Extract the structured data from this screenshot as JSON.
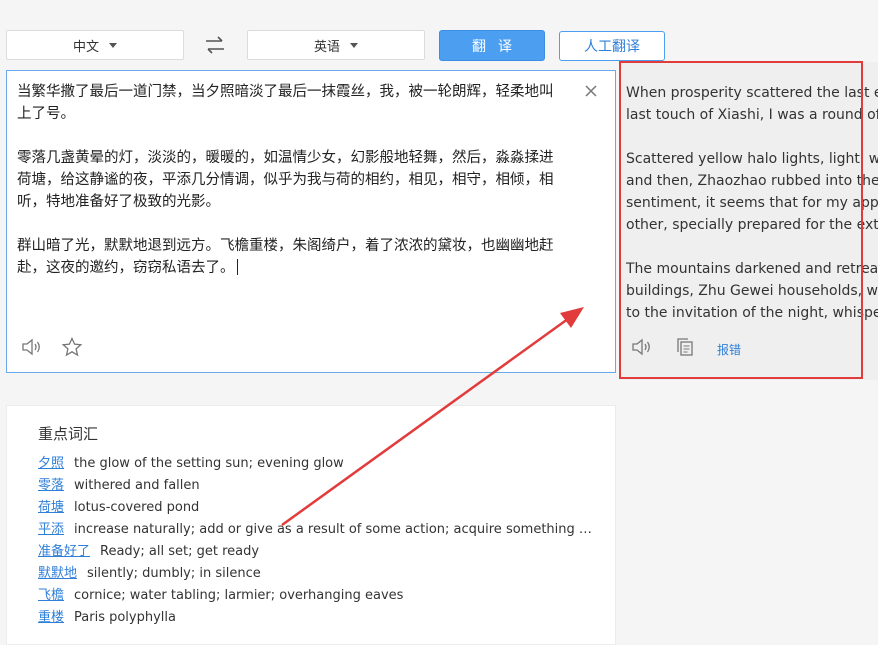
{
  "toolbar": {
    "source_lang": "中文",
    "target_lang": "英语",
    "translate_button": "翻译",
    "human_translate_button": "人工翻译"
  },
  "source": {
    "paragraphs": [
      "当繁华撒了最后一道门禁，当夕照暗淡了最后一抹霞丝，我，被一轮朗辉，轻柔地叫上了号。",
      "零落几盏黄晕的灯，淡淡的，暖暖的，如温情少女，幻影般地轻舞，然后，淼淼揉进荷塘，给这静谧的夜，平添几分情调，似乎为我与荷的相约，相见，相守，相倾，相听，特地准备好了极致的光影。",
      "群山暗了光，默默地退到远方。飞檐重楼，朱阁绮户，着了浓浓的黛妆，也幽幽地赶赴，这夜的邀约，窃窃私语去了。"
    ]
  },
  "result": {
    "paragraphs": [
      [
        "When prosperity scattered the last entrance guard, when the sunset dimmed the",
        "last touch of Xiashi, I was a round of bright light, gently called up."
      ],
      [
        "Scattered yellow halo lights, light, warm, like a warm girl, dancing like a phantom,",
        "and then, Zhaozhao rubbed into the lotus pond, adding a touch of charm to this quiet night. The",
        "sentiment, it seems that for my appointment with the lotus, meet, keep, pour, listen to each",
        "other, specially prepared for the extreme light and shadow."
      ],
      [
        "The mountains darkened and retreated silently to the distance. Flying eaves and",
        "buildings, Zhu Gewei households, wearing thick makeup, also quietly rushed",
        "to the invitation of the night, whispered."
      ]
    ],
    "report_label": "报错"
  },
  "vocab": {
    "title": "重点词汇",
    "items": [
      {
        "word": "夕照",
        "def": "the glow of the setting sun; evening glow"
      },
      {
        "word": "零落",
        "def": "withered and fallen"
      },
      {
        "word": "荷塘",
        "def": "lotus-covered pond"
      },
      {
        "word": "平添",
        "def": "increase naturally; add or give as a result of some action; acquire something u..."
      },
      {
        "word": "准备好了",
        "def": "Ready; all set; get ready"
      },
      {
        "word": "默默地",
        "def": "silently; dumbly; in silence"
      },
      {
        "word": "飞檐",
        "def": "cornice; water tabling; larmier; overhanging eaves"
      },
      {
        "word": "重楼",
        "def": "Paris polyphylla"
      }
    ]
  },
  "icons": {
    "speaker": "speaker-icon",
    "star": "star-icon",
    "copy": "copy-icon",
    "close": "close-icon",
    "swap": "swap-icon"
  },
  "annotation_color": "#e23b3b",
  "accent_color": "#4c9ef1"
}
